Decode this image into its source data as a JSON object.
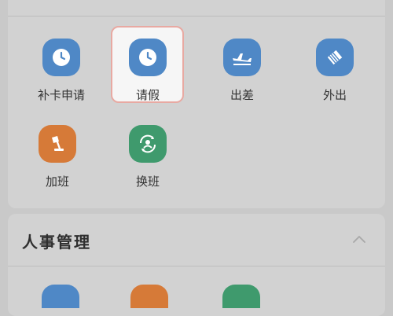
{
  "top_section": {
    "title_fragment": "",
    "apps": [
      {
        "label": "补卡申请",
        "icon": "clock-icon",
        "color": "#4f88c6"
      },
      {
        "label": "请假",
        "icon": "clock-icon",
        "color": "#4f88c6",
        "highlighted": true
      },
      {
        "label": "出差",
        "icon": "airplane-icon",
        "color": "#4f88c6"
      },
      {
        "label": "外出",
        "icon": "outing-icon",
        "color": "#4f88c6"
      },
      {
        "label": "加班",
        "icon": "desk-lamp-icon",
        "color": "#d67a38"
      },
      {
        "label": "换班",
        "icon": "swap-person-icon",
        "color": "#3f9a6d"
      }
    ]
  },
  "hr_section": {
    "title": "人事管理",
    "collapse_icon": "chevron-up-icon",
    "peek_icon_colors": [
      "#4f88c6",
      "#d67a38",
      "#3f9a6d"
    ]
  }
}
